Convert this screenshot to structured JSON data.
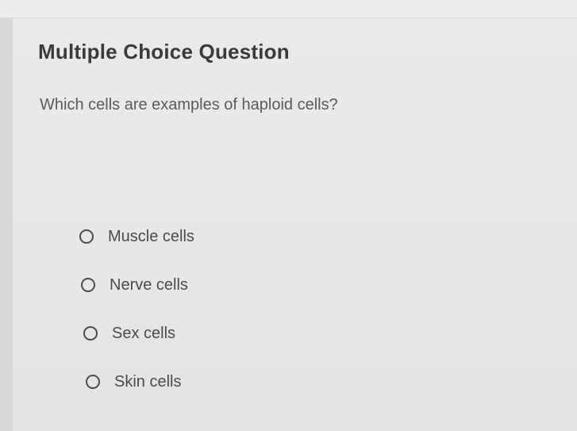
{
  "question": {
    "type_label": "Multiple Choice Question",
    "prompt": "Which cells are examples of haploid cells?"
  },
  "options": [
    {
      "label": "Muscle cells",
      "selected": false
    },
    {
      "label": "Nerve cells",
      "selected": false
    },
    {
      "label": "Sex cells",
      "selected": false
    },
    {
      "label": "Skin cells",
      "selected": false
    }
  ],
  "colors": {
    "background": "#e4e6e5",
    "heading": "#3a3a3c",
    "text": "#5a5b5d",
    "radio_border": "#4b4c4e"
  }
}
